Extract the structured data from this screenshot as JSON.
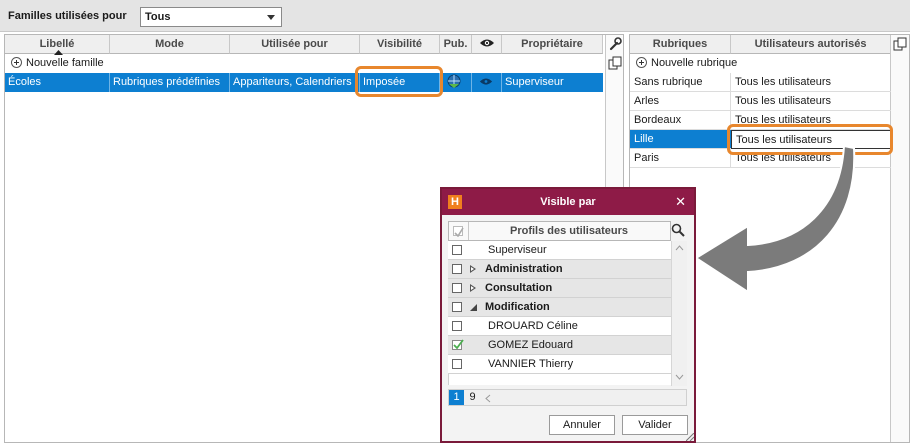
{
  "filter": {
    "label": "Familles utilisées pour",
    "value": "Tous"
  },
  "families": {
    "columns": [
      "Libellé",
      "Mode",
      "Utilisée pour",
      "Visibilité",
      "Pub.",
      "Propriétaire"
    ],
    "new_label": "Nouvelle famille",
    "row": {
      "libelle": "Écoles",
      "mode": "Rubriques prédéfinies",
      "utilisee": "Appariteurs, Calendriers",
      "visibilite": "Imposée",
      "proprietaire": "Superviseur"
    }
  },
  "rubriques": {
    "columns": [
      "Rubriques",
      "Utilisateurs autorisés"
    ],
    "new_label": "Nouvelle rubrique",
    "rows": [
      {
        "name": "Sans rubrique",
        "users": "Tous les utilisateurs"
      },
      {
        "name": "Arles",
        "users": "Tous les utilisateurs"
      },
      {
        "name": "Bordeaux",
        "users": "Tous les utilisateurs"
      },
      {
        "name": "Lille",
        "users": "Tous les utilisateurs"
      },
      {
        "name": "Paris",
        "users": "Tous les utilisateurs"
      }
    ]
  },
  "dialog": {
    "title": "Visible par",
    "header": "Profils des utilisateurs",
    "rows": [
      {
        "label": "Superviseur"
      },
      {
        "label": "Administration"
      },
      {
        "label": "Consultation"
      },
      {
        "label": "Modification"
      },
      {
        "label": "DROUARD Céline"
      },
      {
        "label": "GOMEZ Edouard"
      },
      {
        "label": "VANNIER Thierry"
      }
    ],
    "page_current": "1",
    "page_total": "9",
    "cancel": "Annuler",
    "ok": "Valider"
  },
  "colors": {
    "selection": "#0d7fd1",
    "highlight": "#e8872d",
    "dialog_title": "#8e1b47",
    "logo": "#f07f1e"
  }
}
